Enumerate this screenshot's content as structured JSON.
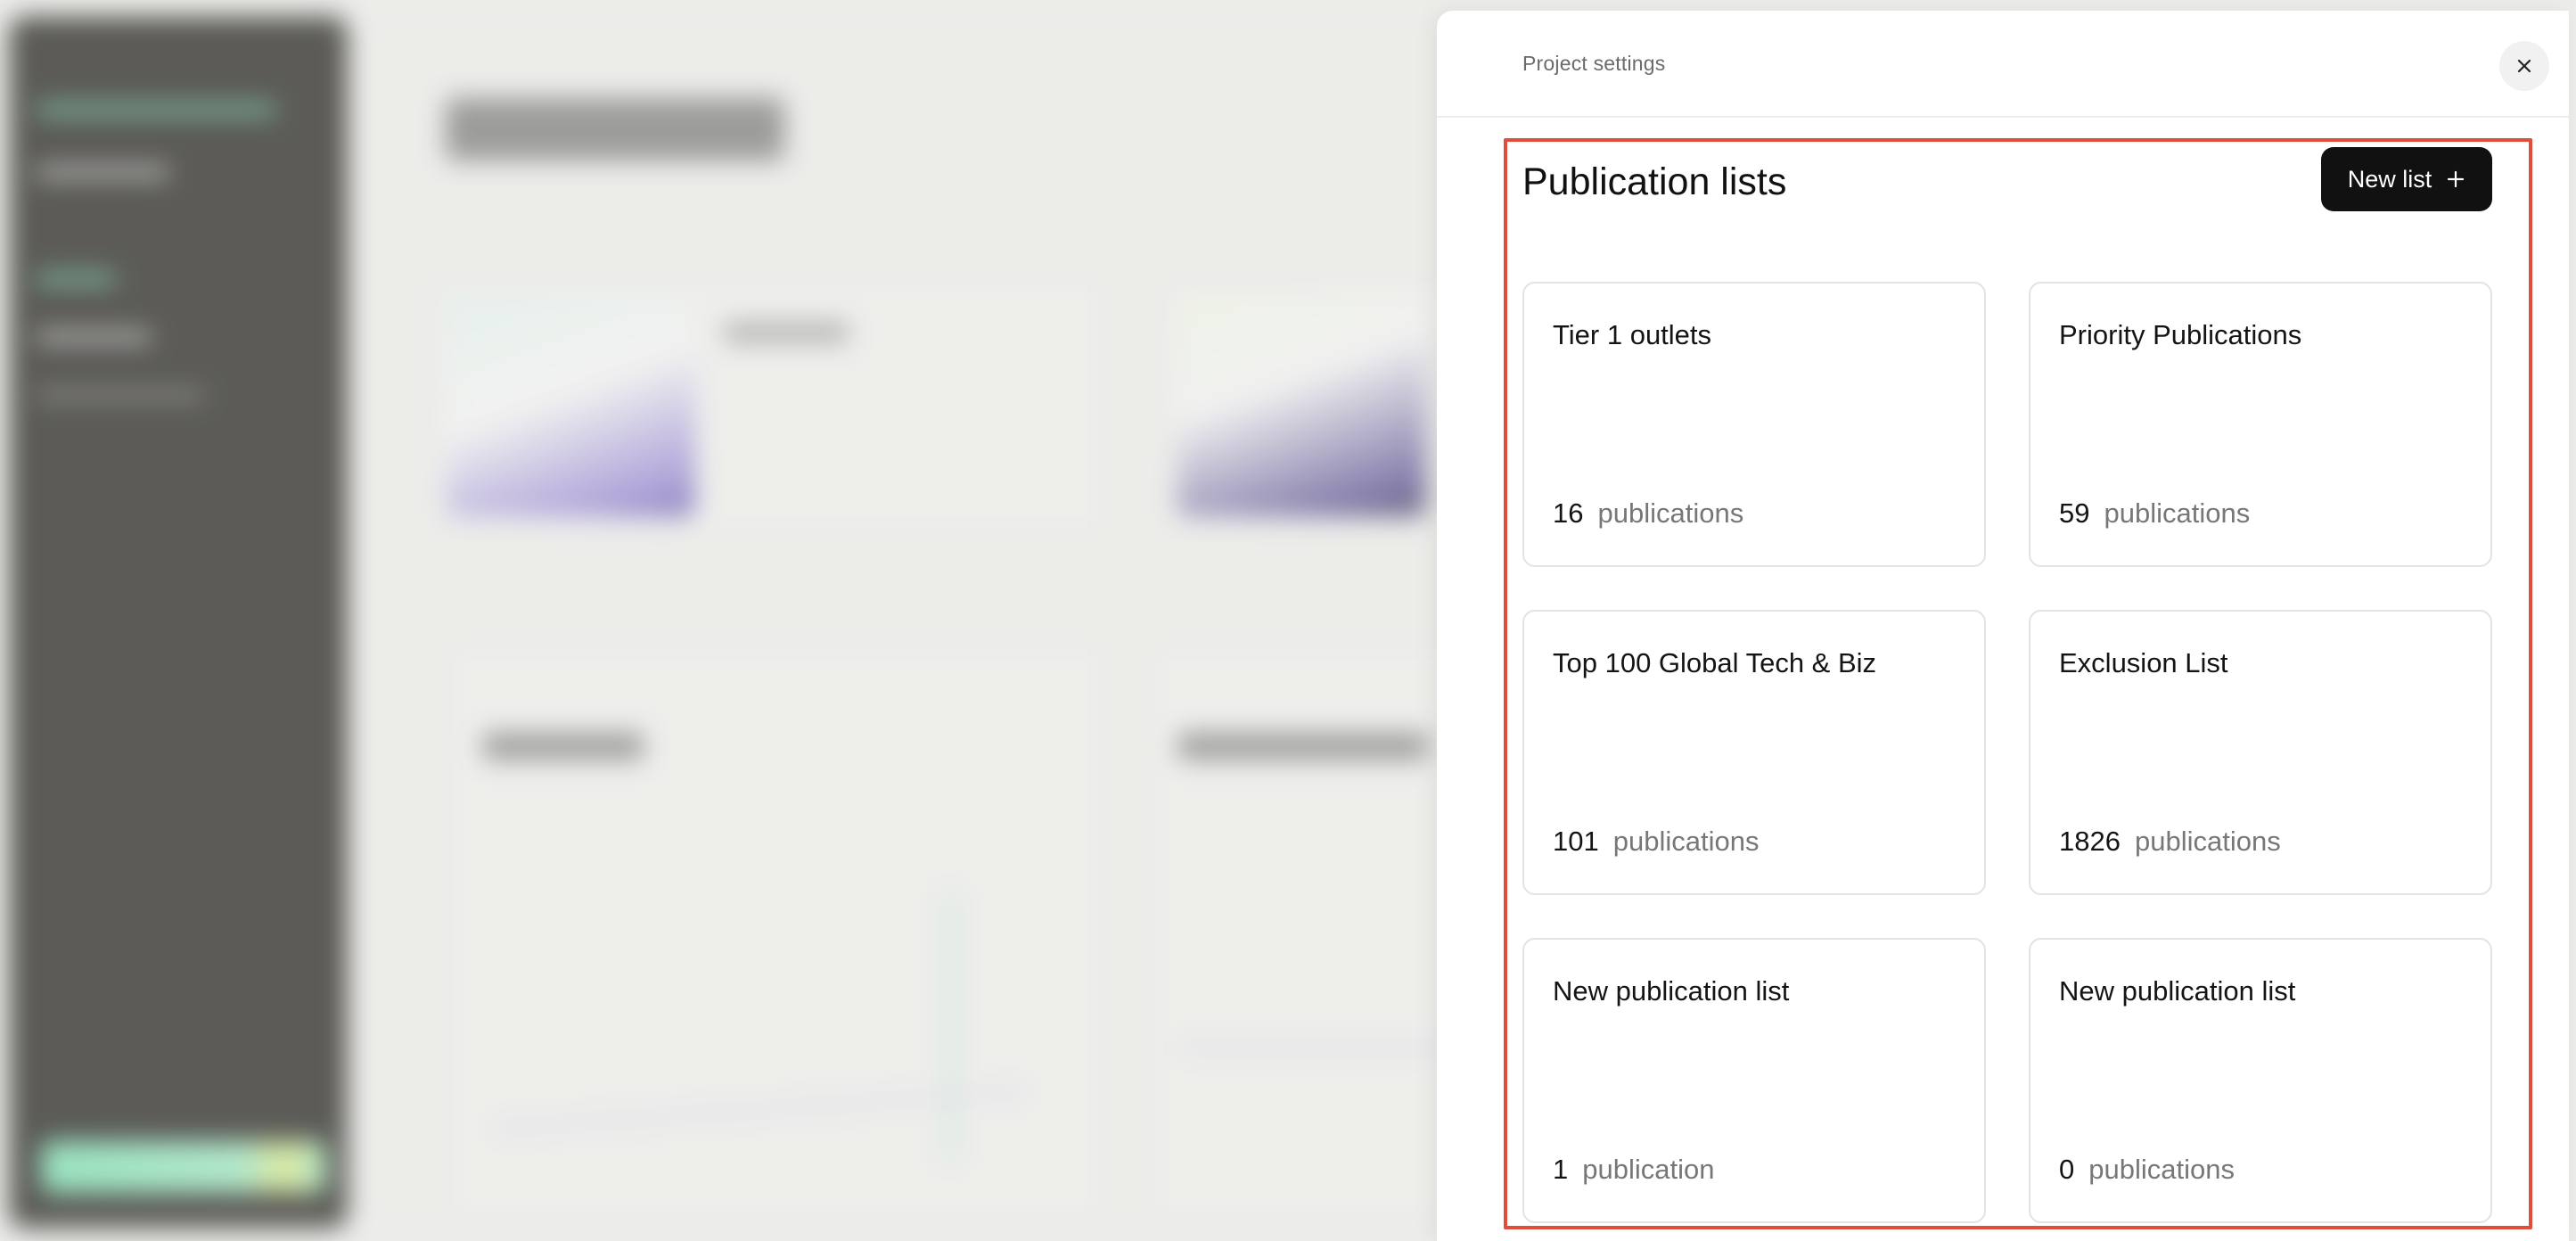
{
  "drawer": {
    "title": "Project settings",
    "close_icon": "close-icon"
  },
  "section": {
    "title": "Publication lists",
    "new_button_label": "New list",
    "new_button_icon": "plus-icon"
  },
  "lists": [
    {
      "name": "Tier 1 outlets",
      "count": "16",
      "unit": "publications"
    },
    {
      "name": "Priority Publications",
      "count": "59",
      "unit": "publications"
    },
    {
      "name": "Top 100 Global Tech & Biz",
      "count": "101",
      "unit": "publications"
    },
    {
      "name": "Exclusion List",
      "count": "1826",
      "unit": "publications"
    },
    {
      "name": "New publication list",
      "count": "1",
      "unit": "publication"
    },
    {
      "name": "New publication list",
      "count": "0",
      "unit": "publications"
    }
  ],
  "colors": {
    "highlight_frame": "#e04e39",
    "primary_button": "#111111",
    "sidebar": "#2c2b27"
  }
}
